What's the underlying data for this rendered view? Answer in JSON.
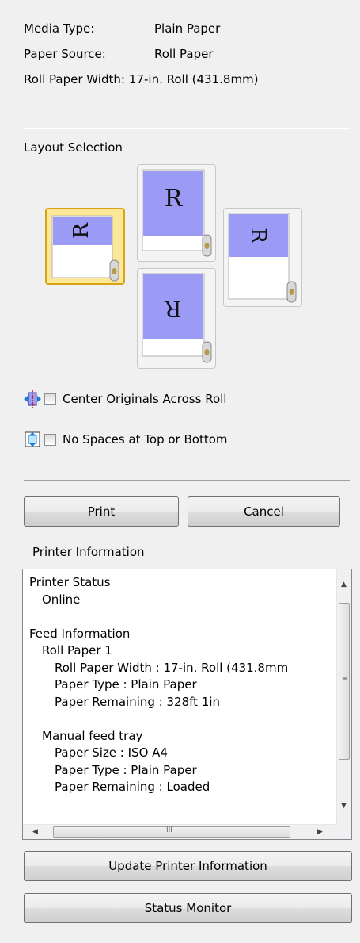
{
  "settings": {
    "media_type_label": "Media Type:",
    "media_type_value": "Plain Paper",
    "paper_source_label": "Paper Source:",
    "paper_source_value": "Roll Paper",
    "roll_width_label": "Roll Paper Width:",
    "roll_width_value": "17-in. Roll (431.8mm)"
  },
  "layout": {
    "title": "Layout Selection",
    "tile_letter": "R",
    "selected_option": "left"
  },
  "options": {
    "center_originals": "Center Originals Across Roll",
    "no_spaces": "No Spaces at Top or Bottom"
  },
  "buttons": {
    "print": "Print",
    "cancel": "Cancel",
    "update": "Update Printer Information",
    "status_monitor": "Status Monitor"
  },
  "printer_info": {
    "title": "Printer Information",
    "lines": [
      "Printer Status",
      "  Online",
      "",
      "Feed Information",
      "  Roll Paper 1",
      "    Roll Paper Width : 17-in. Roll (431.8mm",
      "    Paper Type : Plain Paper",
      "    Paper Remaining : 328ft 1in",
      "",
      "  Manual feed tray",
      "    Paper Size : ISO A4",
      "    Paper Type : Plain Paper",
      "    Paper Remaining : Loaded"
    ]
  },
  "icons": {
    "center_icon": "center-originals-icon",
    "no_spaces_icon": "no-spaces-icon"
  },
  "colors": {
    "paper_blue": "#9b9bf5",
    "selected_fill": "#fde89a",
    "selected_border": "#d8a416"
  }
}
